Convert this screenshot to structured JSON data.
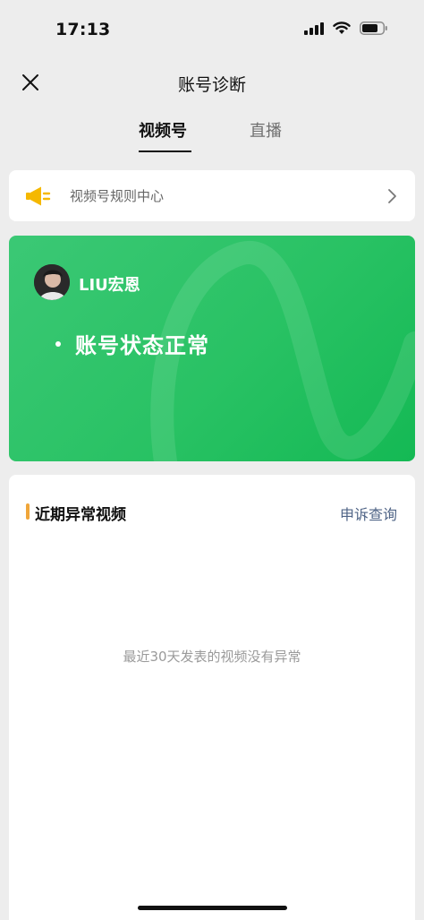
{
  "status_bar": {
    "time": "17:13",
    "icons": [
      "signal-icon",
      "wifi-icon",
      "battery-icon"
    ]
  },
  "nav": {
    "title": "账号诊断",
    "close_icon": "close-icon"
  },
  "tabs": [
    {
      "label": "视频号",
      "active": true
    },
    {
      "label": "直播",
      "active": false
    }
  ],
  "rules": {
    "label": "视频号规则中心",
    "icon": "speaker-icon",
    "chevron_icon": "chevron-right-icon"
  },
  "account": {
    "username": "LIU宏恩",
    "status": "账号状态正常"
  },
  "abnormal": {
    "title": "近期异常视频",
    "link": "申诉查询",
    "empty": "最近30天发表的视频没有异常"
  },
  "colors": {
    "accent_green": "#22c05e",
    "section_bar": "#f0a63a",
    "link": "#4f6486",
    "speaker": "#f5b800"
  }
}
